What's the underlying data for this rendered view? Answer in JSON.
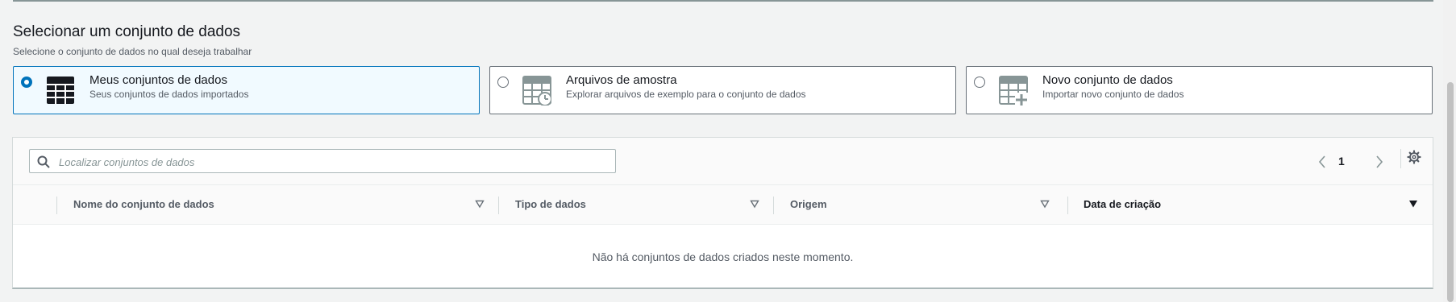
{
  "section": {
    "title": "Selecionar um conjunto de dados",
    "subtitle": "Selecione o conjunto de dados no qual deseja trabalhar"
  },
  "options": [
    {
      "label": "Meus conjuntos de dados",
      "description": "Seus conjuntos de dados importados",
      "selected": true,
      "icon": "table-icon"
    },
    {
      "label": "Arquivos de amostra",
      "description": "Explorar arquivos de exemplo para o conjunto de dados",
      "selected": false,
      "icon": "sample-table-icon"
    },
    {
      "label": "Novo conjunto de dados",
      "description": "Importar novo conjunto de dados",
      "selected": false,
      "icon": "add-table-icon"
    }
  ],
  "search": {
    "placeholder": "Localizar conjuntos de dados",
    "value": ""
  },
  "pagination": {
    "current_page": "1"
  },
  "table": {
    "columns": [
      {
        "label": "Nome do conjunto de dados",
        "sorted": false
      },
      {
        "label": "Tipo de dados",
        "sorted": false
      },
      {
        "label": "Origem",
        "sorted": false
      },
      {
        "label": "Data de criação",
        "sorted": true
      }
    ],
    "empty_message": "Não há conjuntos de dados criados neste momento."
  },
  "colors": {
    "accent": "#0073bb",
    "selected_bg": "#f1faff",
    "page_bg": "#f2f3f3"
  }
}
